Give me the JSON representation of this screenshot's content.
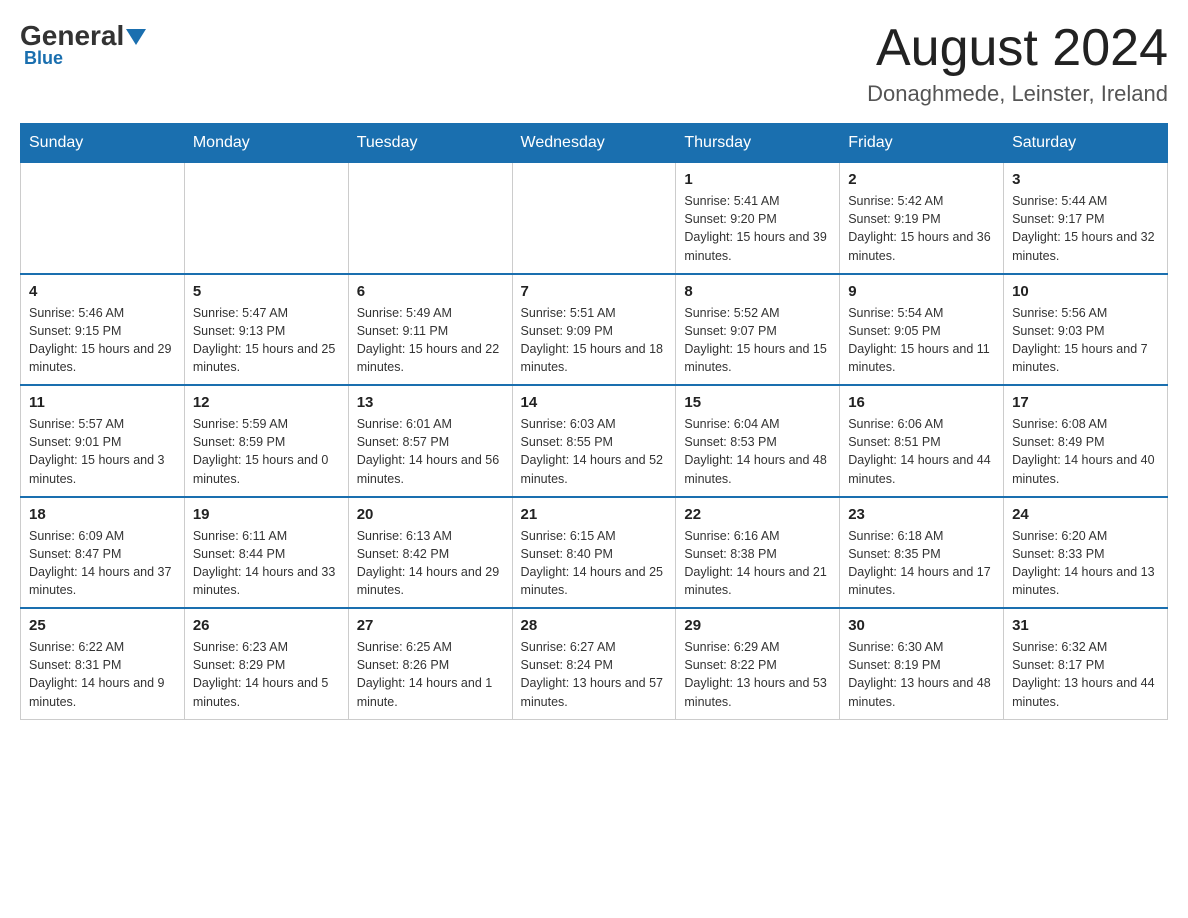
{
  "header": {
    "logo": {
      "general": "General",
      "blue": "Blue"
    },
    "title": "August 2024",
    "subtitle": "Donaghmede, Leinster, Ireland"
  },
  "weekdays": [
    "Sunday",
    "Monday",
    "Tuesday",
    "Wednesday",
    "Thursday",
    "Friday",
    "Saturday"
  ],
  "weeks": [
    [
      {
        "day": "",
        "info": ""
      },
      {
        "day": "",
        "info": ""
      },
      {
        "day": "",
        "info": ""
      },
      {
        "day": "",
        "info": ""
      },
      {
        "day": "1",
        "info": "Sunrise: 5:41 AM\nSunset: 9:20 PM\nDaylight: 15 hours and 39 minutes."
      },
      {
        "day": "2",
        "info": "Sunrise: 5:42 AM\nSunset: 9:19 PM\nDaylight: 15 hours and 36 minutes."
      },
      {
        "day": "3",
        "info": "Sunrise: 5:44 AM\nSunset: 9:17 PM\nDaylight: 15 hours and 32 minutes."
      }
    ],
    [
      {
        "day": "4",
        "info": "Sunrise: 5:46 AM\nSunset: 9:15 PM\nDaylight: 15 hours and 29 minutes."
      },
      {
        "day": "5",
        "info": "Sunrise: 5:47 AM\nSunset: 9:13 PM\nDaylight: 15 hours and 25 minutes."
      },
      {
        "day": "6",
        "info": "Sunrise: 5:49 AM\nSunset: 9:11 PM\nDaylight: 15 hours and 22 minutes."
      },
      {
        "day": "7",
        "info": "Sunrise: 5:51 AM\nSunset: 9:09 PM\nDaylight: 15 hours and 18 minutes."
      },
      {
        "day": "8",
        "info": "Sunrise: 5:52 AM\nSunset: 9:07 PM\nDaylight: 15 hours and 15 minutes."
      },
      {
        "day": "9",
        "info": "Sunrise: 5:54 AM\nSunset: 9:05 PM\nDaylight: 15 hours and 11 minutes."
      },
      {
        "day": "10",
        "info": "Sunrise: 5:56 AM\nSunset: 9:03 PM\nDaylight: 15 hours and 7 minutes."
      }
    ],
    [
      {
        "day": "11",
        "info": "Sunrise: 5:57 AM\nSunset: 9:01 PM\nDaylight: 15 hours and 3 minutes."
      },
      {
        "day": "12",
        "info": "Sunrise: 5:59 AM\nSunset: 8:59 PM\nDaylight: 15 hours and 0 minutes."
      },
      {
        "day": "13",
        "info": "Sunrise: 6:01 AM\nSunset: 8:57 PM\nDaylight: 14 hours and 56 minutes."
      },
      {
        "day": "14",
        "info": "Sunrise: 6:03 AM\nSunset: 8:55 PM\nDaylight: 14 hours and 52 minutes."
      },
      {
        "day": "15",
        "info": "Sunrise: 6:04 AM\nSunset: 8:53 PM\nDaylight: 14 hours and 48 minutes."
      },
      {
        "day": "16",
        "info": "Sunrise: 6:06 AM\nSunset: 8:51 PM\nDaylight: 14 hours and 44 minutes."
      },
      {
        "day": "17",
        "info": "Sunrise: 6:08 AM\nSunset: 8:49 PM\nDaylight: 14 hours and 40 minutes."
      }
    ],
    [
      {
        "day": "18",
        "info": "Sunrise: 6:09 AM\nSunset: 8:47 PM\nDaylight: 14 hours and 37 minutes."
      },
      {
        "day": "19",
        "info": "Sunrise: 6:11 AM\nSunset: 8:44 PM\nDaylight: 14 hours and 33 minutes."
      },
      {
        "day": "20",
        "info": "Sunrise: 6:13 AM\nSunset: 8:42 PM\nDaylight: 14 hours and 29 minutes."
      },
      {
        "day": "21",
        "info": "Sunrise: 6:15 AM\nSunset: 8:40 PM\nDaylight: 14 hours and 25 minutes."
      },
      {
        "day": "22",
        "info": "Sunrise: 6:16 AM\nSunset: 8:38 PM\nDaylight: 14 hours and 21 minutes."
      },
      {
        "day": "23",
        "info": "Sunrise: 6:18 AM\nSunset: 8:35 PM\nDaylight: 14 hours and 17 minutes."
      },
      {
        "day": "24",
        "info": "Sunrise: 6:20 AM\nSunset: 8:33 PM\nDaylight: 14 hours and 13 minutes."
      }
    ],
    [
      {
        "day": "25",
        "info": "Sunrise: 6:22 AM\nSunset: 8:31 PM\nDaylight: 14 hours and 9 minutes."
      },
      {
        "day": "26",
        "info": "Sunrise: 6:23 AM\nSunset: 8:29 PM\nDaylight: 14 hours and 5 minutes."
      },
      {
        "day": "27",
        "info": "Sunrise: 6:25 AM\nSunset: 8:26 PM\nDaylight: 14 hours and 1 minute."
      },
      {
        "day": "28",
        "info": "Sunrise: 6:27 AM\nSunset: 8:24 PM\nDaylight: 13 hours and 57 minutes."
      },
      {
        "day": "29",
        "info": "Sunrise: 6:29 AM\nSunset: 8:22 PM\nDaylight: 13 hours and 53 minutes."
      },
      {
        "day": "30",
        "info": "Sunrise: 6:30 AM\nSunset: 8:19 PM\nDaylight: 13 hours and 48 minutes."
      },
      {
        "day": "31",
        "info": "Sunrise: 6:32 AM\nSunset: 8:17 PM\nDaylight: 13 hours and 44 minutes."
      }
    ]
  ]
}
